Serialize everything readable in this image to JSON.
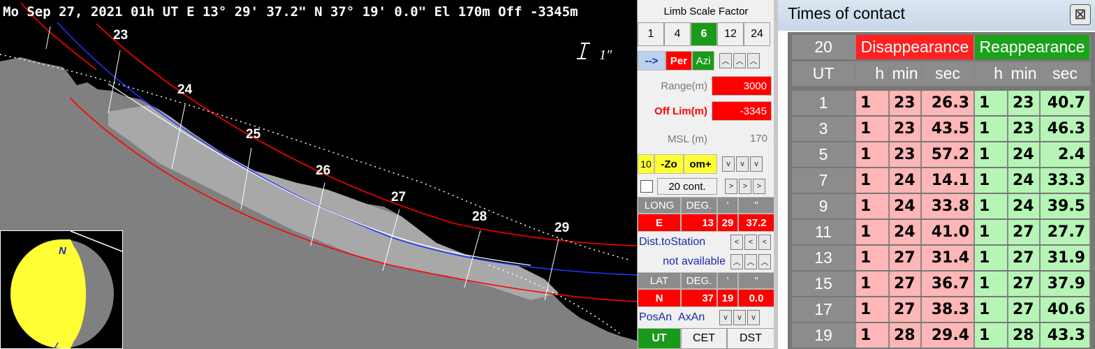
{
  "plot": {
    "header": "Mo Sep  27, 2021 01h UT  E  13°  29' 37.2\"  N  37° 19'   0.0\" El   170m  Off -3345m",
    "scale_label": "1″",
    "contact_labels": [
      "23",
      "24",
      "25",
      "26",
      "27",
      "28",
      "29"
    ],
    "moon_inset": {
      "north_label": "N"
    }
  },
  "panel": {
    "limb_scale_title": "Limb Scale Factor",
    "scale_options": [
      "1",
      "4",
      "6",
      "12",
      "24"
    ],
    "scale_selected": "6",
    "arrow_label": "-->",
    "per_label": "Per",
    "azi_label": "Azi",
    "range_label": "Range(m)",
    "range_value": "3000",
    "offlim_label": "Off Lim(m)",
    "offlim_value": "-3345",
    "msl_label": "MSL (m)",
    "msl_value": "170",
    "zoom_value": "10",
    "zoom_minus": "-Zo",
    "zoom_plus": "om+",
    "cont_label": "20 cont.",
    "long_header": [
      "LONG",
      "DEG.",
      "'",
      "\""
    ],
    "long_values": [
      "E",
      "13",
      "29",
      "37.2"
    ],
    "dist_label": "Dist.toStation",
    "not_available": "not available",
    "lat_header": [
      "LAT",
      "DEG.",
      "'",
      "\""
    ],
    "lat_values": [
      "N",
      "37",
      "19",
      "0.0"
    ],
    "posan_label": "PosAn",
    "axan_label": "AxAn",
    "time_tabs": [
      "UT",
      "CET",
      "DST"
    ],
    "time_selected": "UT"
  },
  "times": {
    "title": "Times of contact",
    "close_label": "☒",
    "count": "20",
    "disappearance_label": "Disappearance",
    "reappearance_label": "Reappearance",
    "ut_label": "UT",
    "col_labels": [
      "h",
      "min",
      "sec",
      "h",
      "min",
      "sec"
    ],
    "rows": [
      {
        "n": "1",
        "d": [
          "1",
          "23",
          "26.3"
        ],
        "r": [
          "1",
          "23",
          "40.7"
        ]
      },
      {
        "n": "3",
        "d": [
          "1",
          "23",
          "43.5"
        ],
        "r": [
          "1",
          "23",
          "46.3"
        ]
      },
      {
        "n": "5",
        "d": [
          "1",
          "23",
          "57.2"
        ],
        "r": [
          "1",
          "24",
          "2.4"
        ]
      },
      {
        "n": "7",
        "d": [
          "1",
          "24",
          "14.1"
        ],
        "r": [
          "1",
          "24",
          "33.3"
        ]
      },
      {
        "n": "9",
        "d": [
          "1",
          "24",
          "33.8"
        ],
        "r": [
          "1",
          "24",
          "39.5"
        ]
      },
      {
        "n": "11",
        "d": [
          "1",
          "24",
          "41.0"
        ],
        "r": [
          "1",
          "27",
          "27.7"
        ]
      },
      {
        "n": "13",
        "d": [
          "1",
          "27",
          "31.4"
        ],
        "r": [
          "1",
          "27",
          "31.9"
        ]
      },
      {
        "n": "15",
        "d": [
          "1",
          "27",
          "36.7"
        ],
        "r": [
          "1",
          "27",
          "37.9"
        ]
      },
      {
        "n": "17",
        "d": [
          "1",
          "27",
          "38.3"
        ],
        "r": [
          "1",
          "27",
          "40.6"
        ]
      },
      {
        "n": "19",
        "d": [
          "1",
          "28",
          "29.4"
        ],
        "r": [
          "1",
          "28",
          "43.3"
        ]
      }
    ]
  },
  "colors": {
    "limb_curve": "#ff0000",
    "path_line": "#0000ff",
    "terrain": "#808080",
    "disappearance_bg": "#ffb6b6",
    "reappearance_bg": "#b6f5b6"
  }
}
